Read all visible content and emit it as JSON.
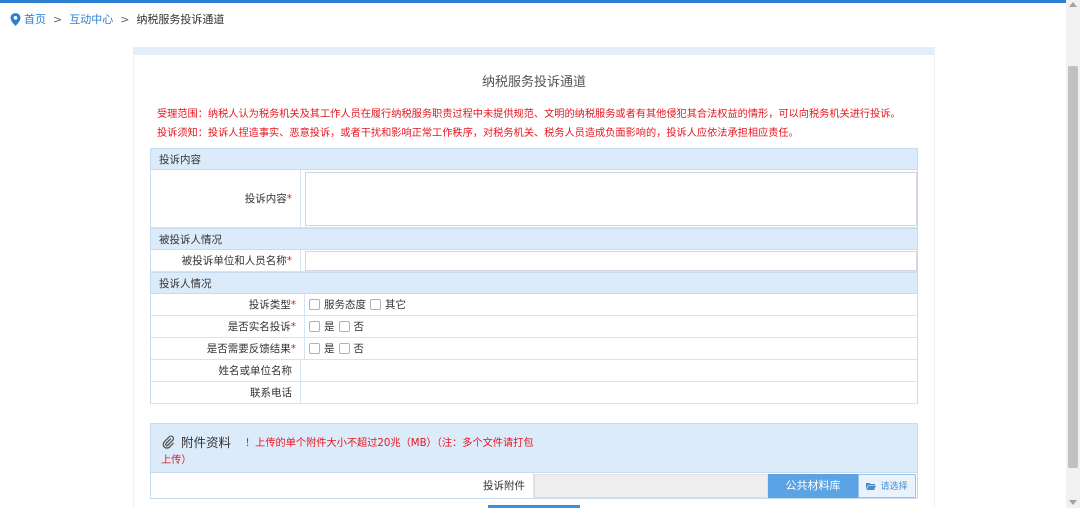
{
  "breadcrumb": {
    "home": "首页",
    "separator": ">",
    "section": "互动中心",
    "current": "纳税服务投诉通道"
  },
  "page": {
    "title": "纳税服务投诉通道",
    "notice_scope": "受理范围：纳税人认为税务机关及其工作人员在履行纳税服务职责过程中未提供规范、文明的纳税服务或者有其他侵犯其合法权益的情形，可以向税务机关进行投诉。",
    "notice_warning": "投诉须知：投诉人捏造事实、恶意投诉，或者干扰和影响正常工作秩序，对税务机关、税务人员造成负面影响的，投诉人应依法承担相应责任。"
  },
  "form": {
    "section_content": "投诉内容",
    "content_label": "投诉内容",
    "section_target": "被投诉人情况",
    "target_label": "被投诉单位和人员名称",
    "section_complainant": "投诉人情况",
    "type_label": "投诉类型",
    "type_options": [
      "服务态度",
      "其它"
    ],
    "realname_label": "是否实名投诉",
    "feedback_label": "是否需要反馈结果",
    "yes": "是",
    "no": "否",
    "name_label": "姓名或单位名称",
    "phone_label": "联系电话",
    "required_mark": "*"
  },
  "attachments": {
    "title": "附件资料",
    "note_line1": "！上传的单个附件大小不超过20兆（MB）（注：多个文件请打包",
    "note_line2": "上传）",
    "file_label": "投诉附件",
    "library_button": "公共材料库",
    "choose_button": "请选择"
  },
  "colors": {
    "accent": "#2a7fd4",
    "warning": "#e5161f",
    "section_bg": "#dcebfa",
    "button": "#5aa4e6"
  }
}
